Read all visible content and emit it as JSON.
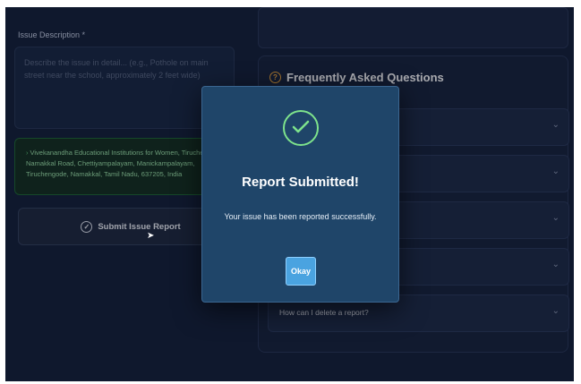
{
  "form": {
    "description_label": "Issue Description *",
    "description_placeholder": "Describe the issue in detail... (e.g., Pothole on main street near the school, approximately 2 feet wide)",
    "location_text": "Vivekanandha Educational Institutions for Women, Tiruchengode - Namakkal Road, Chettiyampalayam, Manickampalayam, Tiruchengode, Namakkal, Tamil Nadu, 637205, India",
    "location_icon": "pin-icon",
    "submit_label": "Submit Issue Report",
    "submit_icon": "check-circle-icon"
  },
  "faq": {
    "title": "Frequently Asked Questions",
    "title_icon": "question-circle-icon",
    "accent_color": "#f2a93b",
    "items": [
      {
        "question": ""
      },
      {
        "question": ""
      },
      {
        "question": ""
      },
      {
        "question": ""
      },
      {
        "question": "How can I delete a report?"
      }
    ]
  },
  "modal": {
    "title": "Report Submitted!",
    "message": "Your issue has been reported successfully.",
    "ok_label": "Okay",
    "icon": "check-circle-icon",
    "success_color": "#7ee38c",
    "button_color": "#4aa3e0"
  }
}
